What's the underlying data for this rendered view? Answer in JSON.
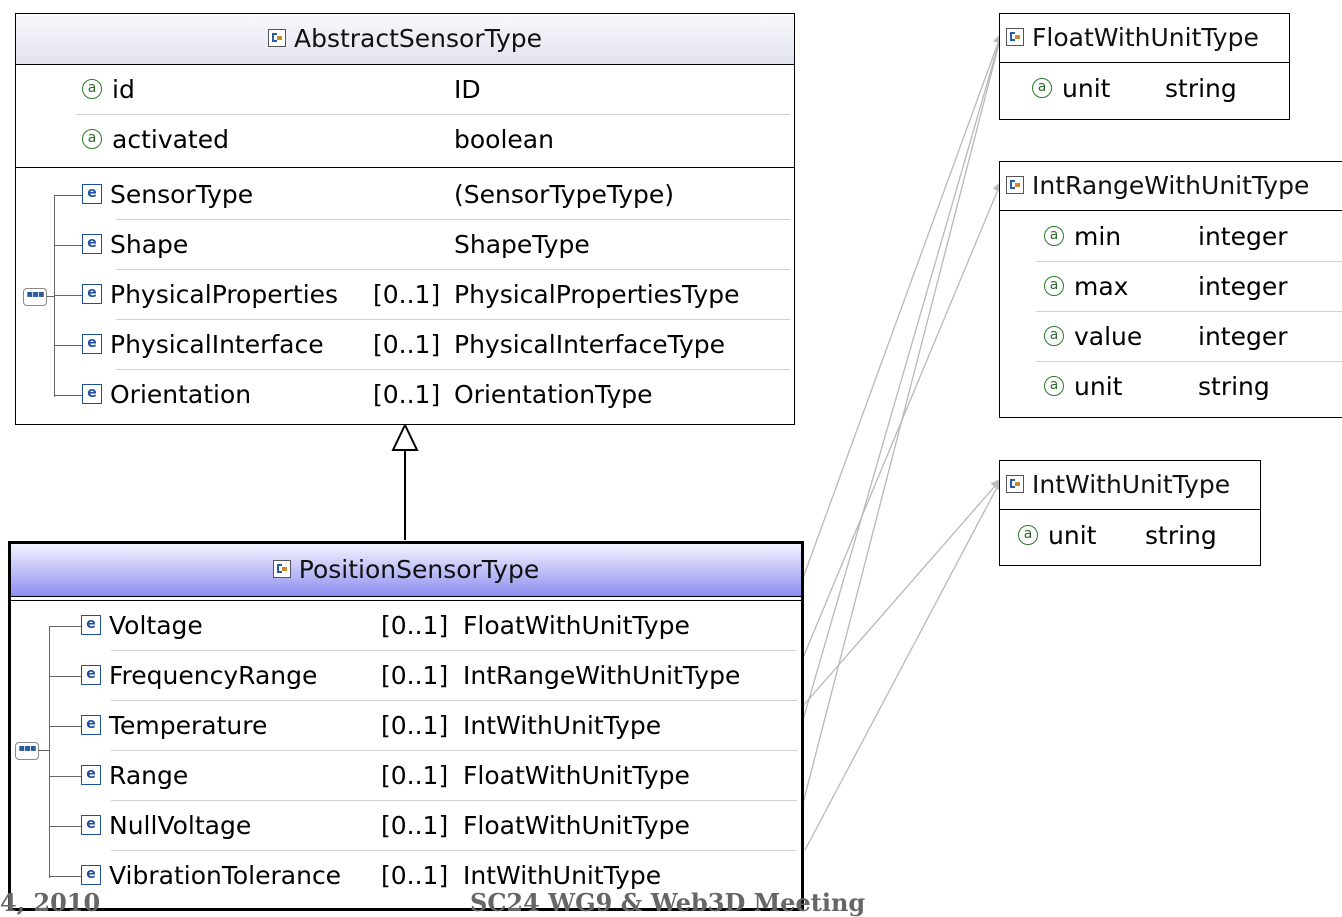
{
  "abstract_sensor": {
    "title": "AbstractSensorType",
    "attributes": [
      {
        "name": "id",
        "type": "ID"
      },
      {
        "name": "activated",
        "type": "boolean"
      }
    ],
    "elements": [
      {
        "name": "SensorType",
        "card": "",
        "type": "(SensorTypeType)"
      },
      {
        "name": "Shape",
        "card": "",
        "type": "ShapeType"
      },
      {
        "name": "PhysicalProperties",
        "card": "[0..1]",
        "type": "PhysicalPropertiesType"
      },
      {
        "name": "PhysicalInterface",
        "card": "[0..1]",
        "type": "PhysicalInterfaceType"
      },
      {
        "name": "Orientation",
        "card": "[0..1]",
        "type": "OrientationType"
      }
    ]
  },
  "position_sensor": {
    "title": "PositionSensorType",
    "elements": [
      {
        "name": "Voltage",
        "card": "[0..1]",
        "type": "FloatWithUnitType"
      },
      {
        "name": "FrequencyRange",
        "card": "[0..1]",
        "type": "IntRangeWithUnitType"
      },
      {
        "name": "Temperature",
        "card": "[0..1]",
        "type": "IntWithUnitType"
      },
      {
        "name": "Range",
        "card": "[0..1]",
        "type": "FloatWithUnitType"
      },
      {
        "name": "NullVoltage",
        "card": "[0..1]",
        "type": "FloatWithUnitType"
      },
      {
        "name": "VibrationTolerance",
        "card": "[0..1]",
        "type": "IntWithUnitType"
      }
    ]
  },
  "float_with_unit": {
    "title": "FloatWithUnitType",
    "attributes": [
      {
        "name": "unit",
        "type": "string"
      }
    ]
  },
  "int_range_with_unit": {
    "title": "IntRangeWithUnitType",
    "attributes": [
      {
        "name": "min",
        "type": "integer"
      },
      {
        "name": "max",
        "type": "integer"
      },
      {
        "name": "value",
        "type": "integer"
      },
      {
        "name": "unit",
        "type": "string"
      }
    ]
  },
  "int_with_unit": {
    "title": "IntWithUnitType",
    "attributes": [
      {
        "name": "unit",
        "type": "string"
      }
    ]
  },
  "icons": {
    "attribute": "a",
    "element": "e",
    "sequence": "▪▪▪"
  },
  "footer": {
    "left": "4, 2010",
    "center": "SC24 WG9 & Web3D Meeting"
  }
}
